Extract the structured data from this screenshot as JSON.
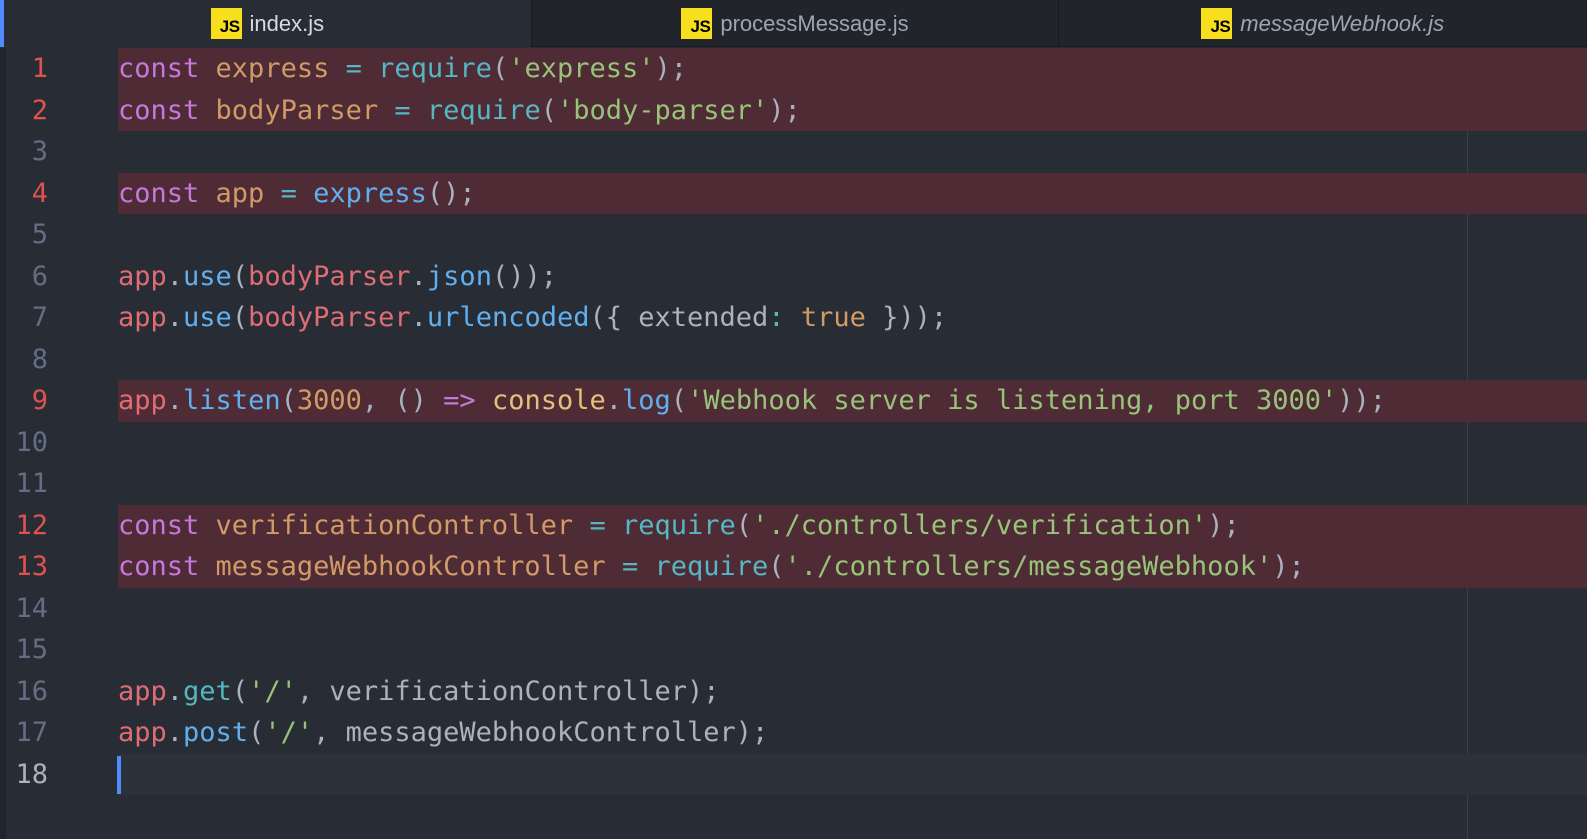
{
  "tabs": [
    {
      "icon": "js-icon",
      "icon_label": "JS",
      "title": "index.js",
      "state": "active"
    },
    {
      "icon": "js-icon",
      "icon_label": "JS",
      "title": "processMessage.js",
      "state": "open"
    },
    {
      "icon": "js-icon",
      "icon_label": "JS",
      "title": "messageWebhook.js",
      "state": "preview"
    }
  ],
  "editor": {
    "highlight_color": "#4e2b35",
    "cursor_line": 18,
    "lines": [
      {
        "n": "1",
        "marked": true,
        "tokens": [
          [
            "k",
            "const"
          ],
          [
            "p",
            " "
          ],
          [
            "vo",
            "express"
          ],
          [
            "p",
            " "
          ],
          [
            "o",
            "="
          ],
          [
            "p",
            " "
          ],
          [
            "fc",
            "require"
          ],
          [
            "p",
            "("
          ],
          [
            "s",
            "'express'"
          ],
          [
            "p",
            ");"
          ]
        ]
      },
      {
        "n": "2",
        "marked": true,
        "tokens": [
          [
            "k",
            "const"
          ],
          [
            "p",
            " "
          ],
          [
            "vo",
            "bodyParser"
          ],
          [
            "p",
            " "
          ],
          [
            "o",
            "="
          ],
          [
            "p",
            " "
          ],
          [
            "fc",
            "require"
          ],
          [
            "p",
            "("
          ],
          [
            "s",
            "'body-parser'"
          ],
          [
            "p",
            ");"
          ]
        ]
      },
      {
        "n": "3",
        "marked": false,
        "tokens": []
      },
      {
        "n": "4",
        "marked": true,
        "tokens": [
          [
            "k",
            "const"
          ],
          [
            "p",
            " "
          ],
          [
            "vo",
            "app"
          ],
          [
            "p",
            " "
          ],
          [
            "o",
            "="
          ],
          [
            "p",
            " "
          ],
          [
            "f",
            "express"
          ],
          [
            "p",
            "();"
          ]
        ]
      },
      {
        "n": "5",
        "marked": false,
        "tokens": []
      },
      {
        "n": "6",
        "marked": false,
        "tokens": [
          [
            "a",
            "app"
          ],
          [
            "p",
            "."
          ],
          [
            "f",
            "use"
          ],
          [
            "p",
            "("
          ],
          [
            "a",
            "bodyParser"
          ],
          [
            "p",
            "."
          ],
          [
            "f",
            "json"
          ],
          [
            "p",
            "());"
          ]
        ]
      },
      {
        "n": "7",
        "marked": false,
        "tokens": [
          [
            "a",
            "app"
          ],
          [
            "p",
            "."
          ],
          [
            "f",
            "use"
          ],
          [
            "p",
            "("
          ],
          [
            "a",
            "bodyParser"
          ],
          [
            "p",
            "."
          ],
          [
            "f",
            "urlencoded"
          ],
          [
            "p",
            "({ extended"
          ],
          [
            "o",
            ":"
          ],
          [
            "p",
            " "
          ],
          [
            "n",
            "true"
          ],
          [
            "p",
            " }));"
          ]
        ]
      },
      {
        "n": "8",
        "marked": false,
        "tokens": []
      },
      {
        "n": "9",
        "marked": true,
        "tokens": [
          [
            "a",
            "app"
          ],
          [
            "p",
            "."
          ],
          [
            "f",
            "listen"
          ],
          [
            "p",
            "("
          ],
          [
            "n",
            "3000"
          ],
          [
            "p",
            ", () "
          ],
          [
            "k",
            "=>"
          ],
          [
            "p",
            " "
          ],
          [
            "c",
            "console"
          ],
          [
            "p",
            "."
          ],
          [
            "f",
            "log"
          ],
          [
            "p",
            "("
          ],
          [
            "s",
            "'Webhook server is listening, port 3000'"
          ],
          [
            "p",
            "));"
          ]
        ]
      },
      {
        "n": "10",
        "marked": false,
        "tokens": []
      },
      {
        "n": "11",
        "marked": false,
        "tokens": []
      },
      {
        "n": "12",
        "marked": true,
        "tokens": [
          [
            "k",
            "const"
          ],
          [
            "p",
            " "
          ],
          [
            "vo",
            "verificationController"
          ],
          [
            "p",
            " "
          ],
          [
            "o",
            "="
          ],
          [
            "p",
            " "
          ],
          [
            "fc",
            "require"
          ],
          [
            "p",
            "("
          ],
          [
            "s",
            "'./controllers/verification'"
          ],
          [
            "p",
            ");"
          ]
        ]
      },
      {
        "n": "13",
        "marked": true,
        "tokens": [
          [
            "k",
            "const"
          ],
          [
            "p",
            " "
          ],
          [
            "vo",
            "messageWebhookController"
          ],
          [
            "p",
            " "
          ],
          [
            "o",
            "="
          ],
          [
            "p",
            " "
          ],
          [
            "fc",
            "require"
          ],
          [
            "p",
            "("
          ],
          [
            "s",
            "'./controllers/messageWebhook'"
          ],
          [
            "p",
            ");"
          ]
        ]
      },
      {
        "n": "14",
        "marked": false,
        "tokens": []
      },
      {
        "n": "15",
        "marked": false,
        "tokens": []
      },
      {
        "n": "16",
        "marked": false,
        "tokens": [
          [
            "a",
            "app"
          ],
          [
            "p",
            "."
          ],
          [
            "fc",
            "get"
          ],
          [
            "p",
            "("
          ],
          [
            "s",
            "'/'"
          ],
          [
            "p",
            ", verificationController);"
          ]
        ]
      },
      {
        "n": "17",
        "marked": false,
        "tokens": [
          [
            "a",
            "app"
          ],
          [
            "p",
            "."
          ],
          [
            "f",
            "post"
          ],
          [
            "p",
            "("
          ],
          [
            "s",
            "'/'"
          ],
          [
            "p",
            ", messageWebhookController);"
          ]
        ]
      },
      {
        "n": "18",
        "marked": false,
        "tokens": []
      }
    ]
  }
}
